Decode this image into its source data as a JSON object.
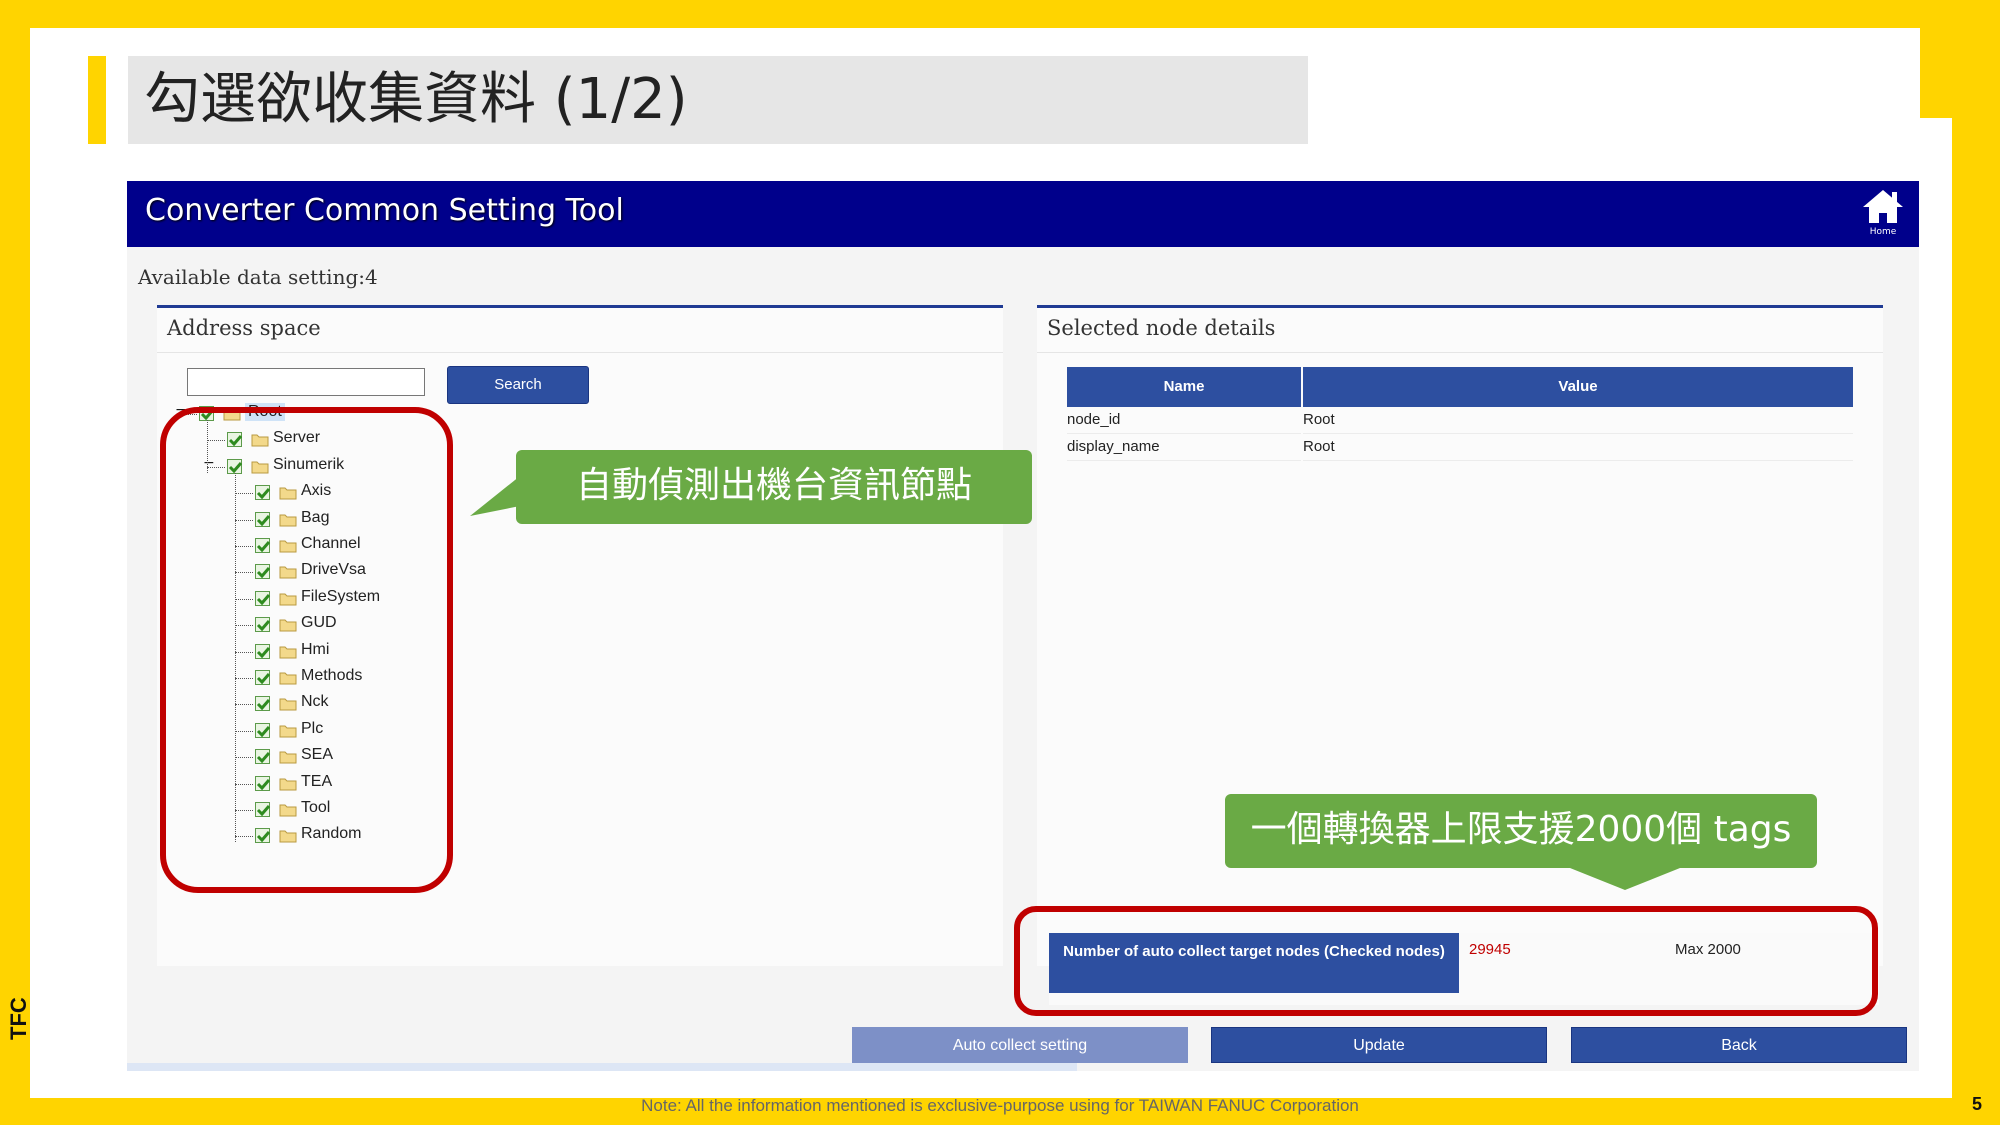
{
  "slide": {
    "title": "勾選欲收集資料 (1/2)",
    "note": "Note: All the information mentioned is exclusive-purpose using for TAIWAN FANUC Corporation",
    "page_number": "5",
    "brand": "TFC",
    "accent_color": "#FFD400"
  },
  "app": {
    "title": "Converter Common Setting Tool",
    "home_label": "Home",
    "available_setting": "Available data setting:4"
  },
  "address_panel": {
    "title": "Address space",
    "search_placeholder": "",
    "search_label": "Search",
    "tree": [
      {
        "label": "Root",
        "level": 0,
        "checked": true,
        "expanded": true,
        "selected": true
      },
      {
        "label": "Server",
        "level": 1,
        "checked": true
      },
      {
        "label": "Sinumerik",
        "level": 1,
        "checked": true,
        "expanded": true
      },
      {
        "label": "Axis",
        "level": 2,
        "checked": true
      },
      {
        "label": "Bag",
        "level": 2,
        "checked": true
      },
      {
        "label": "Channel",
        "level": 2,
        "checked": true
      },
      {
        "label": "DriveVsa",
        "level": 2,
        "checked": true
      },
      {
        "label": "FileSystem",
        "level": 2,
        "checked": true
      },
      {
        "label": "GUD",
        "level": 2,
        "checked": true
      },
      {
        "label": "Hmi",
        "level": 2,
        "checked": true
      },
      {
        "label": "Methods",
        "level": 2,
        "checked": true
      },
      {
        "label": "Nck",
        "level": 2,
        "checked": true
      },
      {
        "label": "Plc",
        "level": 2,
        "checked": true
      },
      {
        "label": "SEA",
        "level": 2,
        "checked": true
      },
      {
        "label": "TEA",
        "level": 2,
        "checked": true
      },
      {
        "label": "Tool",
        "level": 2,
        "checked": true
      },
      {
        "label": "Random",
        "level": 2,
        "checked": true
      }
    ]
  },
  "callouts": {
    "detect": "自動偵測出機台資訊節點",
    "limit": "一個轉換器上限支援2000個 tags"
  },
  "details_panel": {
    "title": "Selected node details",
    "columns": [
      "Name",
      "Value"
    ],
    "rows": [
      [
        "node_id",
        "Root"
      ],
      [
        "display_name",
        "Root"
      ]
    ]
  },
  "auto_collect": {
    "label": "Number of auto collect target nodes (Checked nodes)",
    "value": "29945",
    "max": "Max 2000"
  },
  "buttons": {
    "auto_collect": "Auto collect setting",
    "update": "Update",
    "back": "Back"
  }
}
